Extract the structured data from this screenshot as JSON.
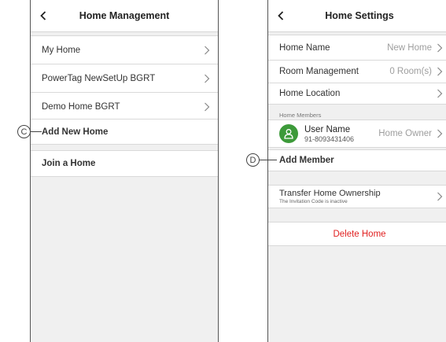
{
  "left_screen": {
    "title": "Home Management",
    "homes": [
      "My Home",
      "PowerTag NewSetUp BGRT",
      "Demo Home BGRT"
    ],
    "add_new_home": "Add New Home",
    "join_home": "Join a Home",
    "callout": "C"
  },
  "right_screen": {
    "title": "Home Settings",
    "home_name": {
      "label": "Home Name",
      "value": "New Home"
    },
    "room_management": {
      "label": "Room Management",
      "value": "0 Room(s)"
    },
    "home_location": {
      "label": "Home Location"
    },
    "members_header": "Home Members",
    "member": {
      "name": "User Name",
      "phone": "91-8093431406",
      "role": "Home Owner"
    },
    "add_member": "Add Member",
    "transfer": {
      "title": "Transfer Home Ownership",
      "subtitle": "The Invitation Code is inactive"
    },
    "delete_home": "Delete Home",
    "callout": "D"
  },
  "colors": {
    "accent_green": "#3d9a3a",
    "danger_red": "#e02020"
  }
}
